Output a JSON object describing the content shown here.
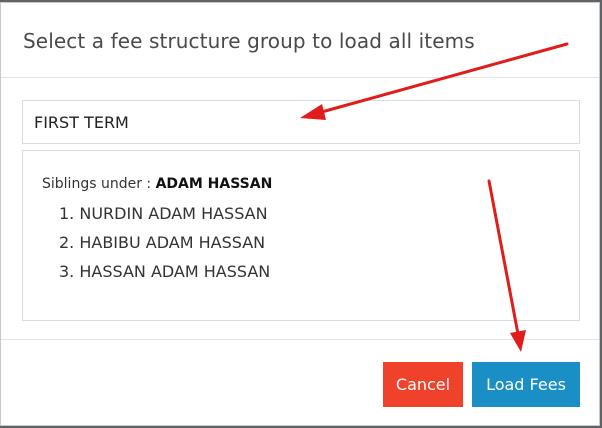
{
  "modal": {
    "title": "Select a fee structure group to load all items"
  },
  "select": {
    "value": "FIRST TERM"
  },
  "siblings": {
    "prefix": "Siblings under : ",
    "parent": "ADAM HASSAN",
    "list": [
      "1. NURDIN ADAM HASSAN",
      "2. HABIBU ADAM HASSAN",
      "3. HASSAN ADAM HASSAN"
    ]
  },
  "footer": {
    "cancel_label": "Cancel",
    "load_label": "Load Fees"
  },
  "colors": {
    "cancel": "#f0422b",
    "load": "#1a8fc6",
    "annotation_arrow": "#e01c1c"
  }
}
